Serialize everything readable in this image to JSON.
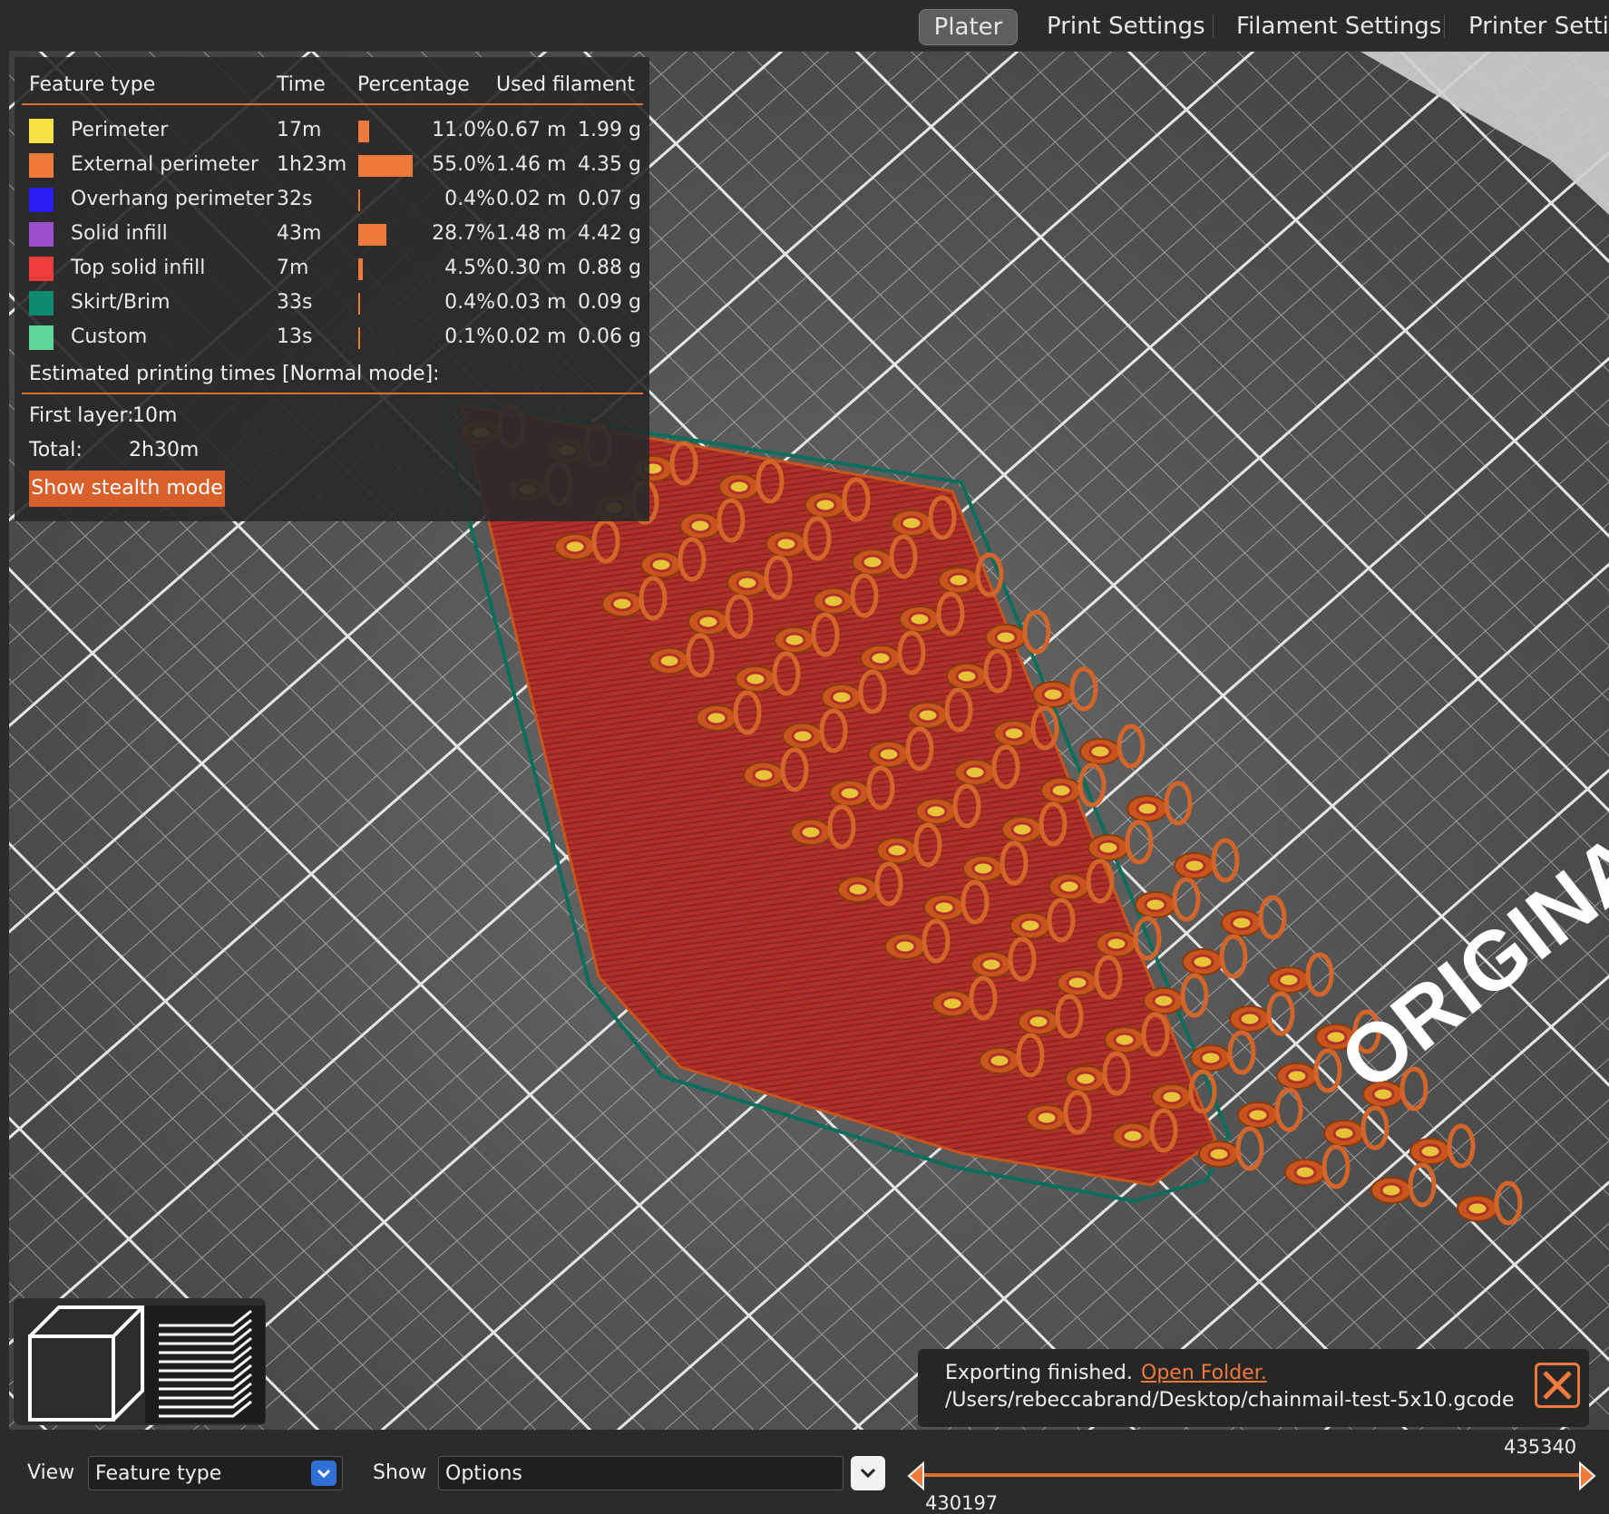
{
  "tabs": [
    {
      "label": "Plater",
      "active": true
    },
    {
      "label": "Print Settings",
      "active": false
    },
    {
      "label": "Filament Settings",
      "active": false
    },
    {
      "label": "Printer Settir",
      "active": false
    }
  ],
  "legend": {
    "headers": {
      "feature": "Feature type",
      "time": "Time",
      "percentage": "Percentage",
      "used_filament": "Used filament"
    },
    "rows": [
      {
        "name": "Perimeter",
        "color": "#f7e244",
        "time": "17m",
        "percentage": "11.0%",
        "percent_value": 11.0,
        "length": "0.67 m",
        "weight": "1.99 g"
      },
      {
        "name": "External perimeter",
        "color": "#f07a3a",
        "time": "1h23m",
        "percentage": "55.0%",
        "percent_value": 55.0,
        "length": "1.46 m",
        "weight": "4.35 g"
      },
      {
        "name": "Overhang perimeter",
        "color": "#2a1cf2",
        "time": "32s",
        "percentage": "0.4%",
        "percent_value": 0.4,
        "length": "0.02 m",
        "weight": "0.07 g"
      },
      {
        "name": "Solid infill",
        "color": "#9b4fcf",
        "time": "43m",
        "percentage": "28.7%",
        "percent_value": 28.7,
        "length": "1.48 m",
        "weight": "4.42 g"
      },
      {
        "name": "Top solid infill",
        "color": "#ee3b3b",
        "time": "7m",
        "percentage": "4.5%",
        "percent_value": 4.5,
        "length": "0.30 m",
        "weight": "0.88 g"
      },
      {
        "name": "Skirt/Brim",
        "color": "#0b8a70",
        "time": "33s",
        "percentage": "0.4%",
        "percent_value": 0.4,
        "length": "0.03 m",
        "weight": "0.09 g"
      },
      {
        "name": "Custom",
        "color": "#5ed49a",
        "time": "13s",
        "percentage": "0.1%",
        "percent_value": 0.1,
        "length": "0.02 m",
        "weight": "0.06 g"
      }
    ],
    "estimated_title": "Estimated printing times [Normal mode]:",
    "first_layer_label": "First layer:",
    "first_layer_value": "10m",
    "total_label": "Total:",
    "total_value": "2h30m",
    "stealth_button": "Show stealth mode"
  },
  "bed_label": "ORIGINAL",
  "notification": {
    "message": "Exporting finished.",
    "link": "Open Folder.",
    "path": "/Users/rebeccabrand/Desktop/chainmail-test-5x10.gcode"
  },
  "bottom": {
    "view_label": "View",
    "view_value": "Feature type",
    "show_label": "Show",
    "show_value": "Options",
    "slider_max": "435340",
    "slider_min": "430197"
  },
  "icons": [
    "3d-view-icon",
    "layers-view-icon",
    "close-icon",
    "chevron-down-icon"
  ]
}
